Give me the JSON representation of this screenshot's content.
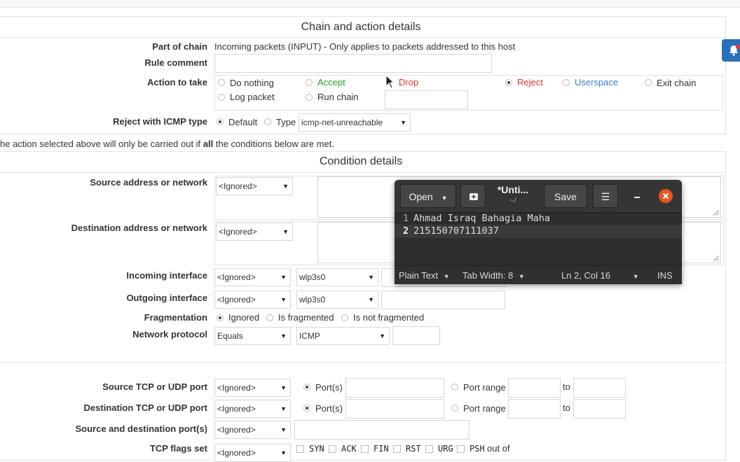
{
  "chain_section": {
    "title": "Chain and action details",
    "part_of_chain_label": "Part of chain",
    "part_of_chain_value": "Incoming packets (INPUT) - Only applies to packets addressed to this host",
    "rule_comment_label": "Rule comment",
    "rule_comment_value": "",
    "action_label": "Action to take",
    "actions": {
      "nothing": "Do nothing",
      "accept": "Accept",
      "drop": "Drop",
      "reject": "Reject",
      "userspace": "Userspace",
      "exit": "Exit chain",
      "log": "Log packet",
      "run": "Run chain"
    },
    "selected_action": "Reject",
    "reject_icmp_label": "Reject with ICMP type",
    "reject_default": "Default",
    "reject_type": "Type",
    "reject_type_select": "icmp-net-unreachable",
    "colors": {
      "accept": "#2a9a2a",
      "drop": "#d9362b",
      "reject": "#d9362b",
      "userspace": "#3a7bd5"
    }
  },
  "conditions_note": {
    "before": "he action selected above will only be carried out if ",
    "bold": "all",
    "after": " the conditions below are met."
  },
  "condition_section": {
    "title": "Condition details",
    "source_label": "Source address or network",
    "source_select": "<Ignored>",
    "dest_label": "Destination address or network",
    "dest_select": "<Ignored>",
    "in_if_label": "Incoming interface",
    "in_if_select": "<Ignored>",
    "in_if_value": "wlp3s0",
    "out_if_label": "Outgoing interface",
    "out_if_select": "<Ignored>",
    "out_if_value": "wlp3s0",
    "frag_label": "Fragmentation",
    "frag_options": [
      "Ignored",
      "Is fragmented",
      "Is not fragmented"
    ],
    "proto_label": "Network protocol",
    "proto_select": "Equals",
    "proto_value": "ICMP",
    "src_port_label": "Source TCP or UDP port",
    "src_port_select": "<Ignored>",
    "dst_port_label": "Destination TCP or UDP port",
    "dst_port_select": "<Ignored>",
    "ports_option": "Port(s)",
    "range_option": "Port range",
    "to_label": "to",
    "sd_port_label": "Source and destination port(s)",
    "sd_port_select": "<Ignored>",
    "tcp_flags_label": "TCP flags set",
    "tcp_flags_select": "<Ignored>",
    "flags": [
      "SYN",
      "ACK",
      "FIN",
      "RST",
      "URG",
      "PSH"
    ],
    "out_of": "out of"
  },
  "gedit": {
    "open_label": "Open",
    "title": "*Unti...",
    "subtitle": "~/",
    "save_label": "Save",
    "lines": [
      {
        "num": "1",
        "text": "Ahmad Israq Bahagia Maha"
      },
      {
        "num": "2",
        "text": "215150707111037"
      }
    ],
    "status": {
      "language": "Plain Text",
      "tab_width": "Tab Width: 8",
      "position": "Ln 2, Col 16",
      "mode": "INS"
    }
  },
  "notification_icon": "bell-icon"
}
